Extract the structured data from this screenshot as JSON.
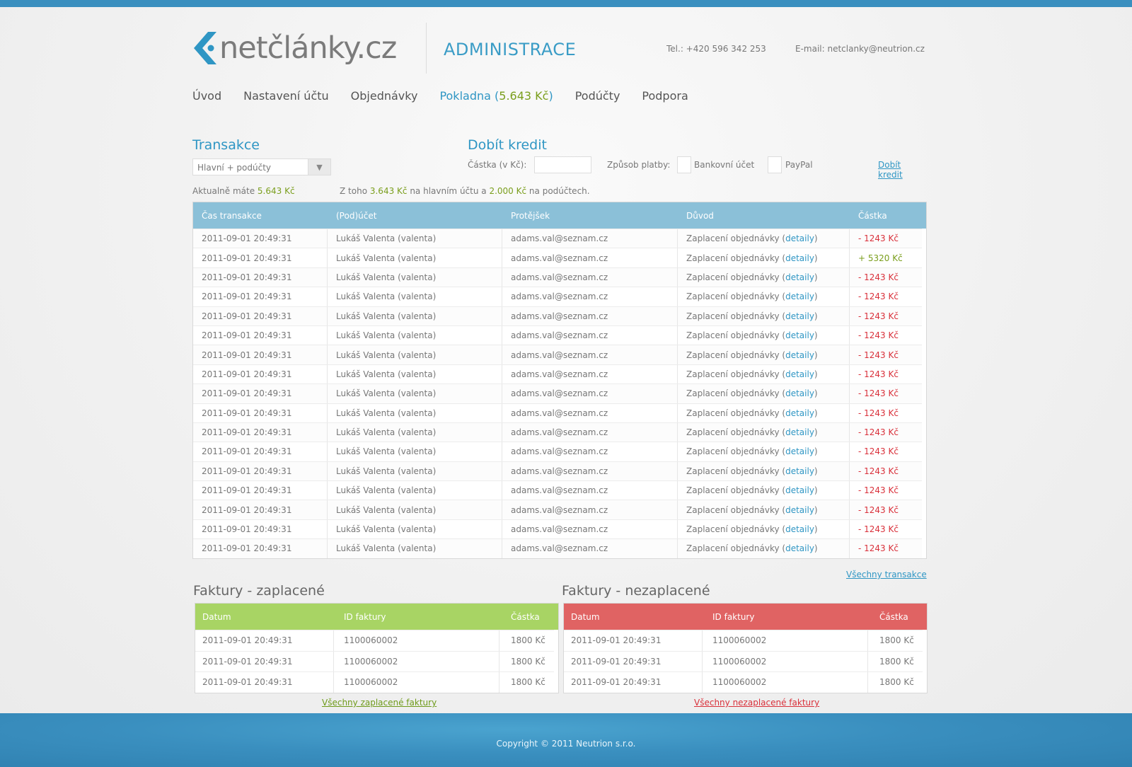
{
  "header": {
    "logo_text": "netčlánky.cz",
    "admin_title": "ADMINISTRACE",
    "tel": "Tel.: +420 596 342 253",
    "email": "E-mail: netclanky@neutrion.cz"
  },
  "nav": {
    "items": [
      "Úvod",
      "Nastavení účtu",
      "Objednávky"
    ],
    "pokladna_label": "Pokladna",
    "pokladna_amount": "5.643 Kč",
    "after_items": [
      "Podúčty",
      "Podpora"
    ]
  },
  "transakce": {
    "title": "Transakce",
    "filter_value": "Hlavní + podúčty",
    "summary_prefix": "Aktualně máte",
    "summary_amount": "5.643 Kč",
    "detail_prefix": "Z toho",
    "detail_main": "3.643 Kč",
    "detail_mid": "na hlavním účtu a",
    "detail_sub": "2.000 Kč",
    "detail_suffix": "na podúčtech."
  },
  "dobit": {
    "title": "Dobít kredit",
    "amount_label": "Částka (v Kč):",
    "amount_value": "",
    "method_label": "Způsob platby:",
    "bank_label": "Bankovní účet",
    "paypal_label": "PayPal",
    "submit_link": "Dobít kredit"
  },
  "tx_table": {
    "headers": [
      "Čas transakce",
      "(Pod)účet",
      "Protějšek",
      "Důvod",
      "Částka"
    ],
    "reason_text": "Zaplacení objednávky",
    "detail_link": "detaily",
    "rows": [
      {
        "time": "2011-09-01 20:49:31",
        "account": "Lukáš Valenta (valenta)",
        "counterparty": "adams.val@seznam.cz",
        "amount": "- 1243 Kč",
        "sign": "neg"
      },
      {
        "time": "2011-09-01 20:49:31",
        "account": "Lukáš Valenta (valenta)",
        "counterparty": "adams.val@seznam.cz",
        "amount": "+ 5320 Kč",
        "sign": "pos"
      },
      {
        "time": "2011-09-01 20:49:31",
        "account": "Lukáš Valenta (valenta)",
        "counterparty": "adams.val@seznam.cz",
        "amount": "- 1243 Kč",
        "sign": "neg"
      },
      {
        "time": "2011-09-01 20:49:31",
        "account": "Lukáš Valenta (valenta)",
        "counterparty": "adams.val@seznam.cz",
        "amount": "- 1243 Kč",
        "sign": "neg"
      },
      {
        "time": "2011-09-01 20:49:31",
        "account": "Lukáš Valenta (valenta)",
        "counterparty": "adams.val@seznam.cz",
        "amount": "- 1243 Kč",
        "sign": "neg"
      },
      {
        "time": "2011-09-01 20:49:31",
        "account": "Lukáš Valenta (valenta)",
        "counterparty": "adams.val@seznam.cz",
        "amount": "- 1243 Kč",
        "sign": "neg"
      },
      {
        "time": "2011-09-01 20:49:31",
        "account": "Lukáš Valenta (valenta)",
        "counterparty": "adams.val@seznam.cz",
        "amount": "- 1243 Kč",
        "sign": "neg"
      },
      {
        "time": "2011-09-01 20:49:31",
        "account": "Lukáš Valenta (valenta)",
        "counterparty": "adams.val@seznam.cz",
        "amount": "- 1243 Kč",
        "sign": "neg"
      },
      {
        "time": "2011-09-01 20:49:31",
        "account": "Lukáš Valenta (valenta)",
        "counterparty": "adams.val@seznam.cz",
        "amount": "- 1243 Kč",
        "sign": "neg"
      },
      {
        "time": "2011-09-01 20:49:31",
        "account": "Lukáš Valenta (valenta)",
        "counterparty": "adams.val@seznam.cz",
        "amount": "- 1243 Kč",
        "sign": "neg"
      },
      {
        "time": "2011-09-01 20:49:31",
        "account": "Lukáš Valenta (valenta)",
        "counterparty": "adams.val@seznam.cz",
        "amount": "- 1243 Kč",
        "sign": "neg"
      },
      {
        "time": "2011-09-01 20:49:31",
        "account": "Lukáš Valenta (valenta)",
        "counterparty": "adams.val@seznam.cz",
        "amount": "- 1243 Kč",
        "sign": "neg"
      },
      {
        "time": "2011-09-01 20:49:31",
        "account": "Lukáš Valenta (valenta)",
        "counterparty": "adams.val@seznam.cz",
        "amount": "- 1243 Kč",
        "sign": "neg"
      },
      {
        "time": "2011-09-01 20:49:31",
        "account": "Lukáš Valenta (valenta)",
        "counterparty": "adams.val@seznam.cz",
        "amount": "- 1243 Kč",
        "sign": "neg"
      },
      {
        "time": "2011-09-01 20:49:31",
        "account": "Lukáš Valenta (valenta)",
        "counterparty": "adams.val@seznam.cz",
        "amount": "- 1243 Kč",
        "sign": "neg"
      },
      {
        "time": "2011-09-01 20:49:31",
        "account": "Lukáš Valenta (valenta)",
        "counterparty": "adams.val@seznam.cz",
        "amount": "- 1243 Kč",
        "sign": "neg"
      },
      {
        "time": "2011-09-01 20:49:31",
        "account": "Lukáš Valenta (valenta)",
        "counterparty": "adams.val@seznam.cz",
        "amount": "- 1243 Kč",
        "sign": "neg"
      }
    ],
    "all_link": "Všechny transakce"
  },
  "invoices_paid": {
    "title": "Faktury - zaplacené",
    "headers": [
      "Datum",
      "ID faktury",
      "Částka"
    ],
    "rows": [
      {
        "date": "2011-09-01 20:49:31",
        "id": "1100060002",
        "amount": "1800 Kč"
      },
      {
        "date": "2011-09-01 20:49:31",
        "id": "1100060002",
        "amount": "1800 Kč"
      },
      {
        "date": "2011-09-01 20:49:31",
        "id": "1100060002",
        "amount": "1800 Kč"
      }
    ],
    "all_link": "Všechny zaplacené faktury"
  },
  "invoices_unpaid": {
    "title": "Faktury - nezaplacené",
    "headers": [
      "Datum",
      "ID faktury",
      "Částka"
    ],
    "rows": [
      {
        "date": "2011-09-01 20:49:31",
        "id": "1100060002",
        "amount": "1800 Kč"
      },
      {
        "date": "2011-09-01 20:49:31",
        "id": "1100060002",
        "amount": "1800 Kč"
      },
      {
        "date": "2011-09-01 20:49:31",
        "id": "1100060002",
        "amount": "1800 Kč"
      }
    ],
    "all_link": "Všechny nezaplacené faktury"
  },
  "footer": {
    "copyright": "Copyright © 2011 Neutrion s.r.o."
  },
  "colors": {
    "brand_blue": "#2f96c4",
    "green": "#7a9e1c",
    "red": "#d9303a",
    "table_head_blue": "#8bc0d8",
    "table_head_green": "#a8d464",
    "table_head_red": "#e06363",
    "footer_blue": "#3a8fbf"
  }
}
